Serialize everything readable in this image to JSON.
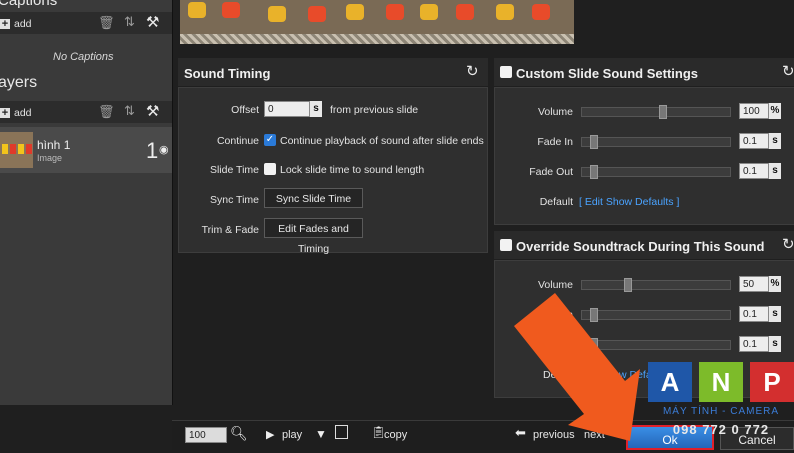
{
  "captions": {
    "title": "Captions",
    "add_label": "add",
    "empty_note": "No Captions"
  },
  "layers": {
    "title": "ayers",
    "add_label": "add",
    "items": [
      {
        "name": "hình 1",
        "type": "Image",
        "number": "1"
      }
    ]
  },
  "sound_timing": {
    "title": "Sound Timing",
    "offset_label": "Offset",
    "offset_value": "0",
    "offset_unit": "s",
    "offset_suffix": "from previous slide",
    "continue_label": "Continue",
    "continue_text": "Continue playback of sound after slide ends",
    "continue_checked": true,
    "slide_time_label": "Slide Time",
    "slide_time_text": "Lock slide time to sound length",
    "slide_time_checked": false,
    "sync_time_label": "Sync Time",
    "sync_button": "Sync Slide Time",
    "trim_label": "Trim & Fade",
    "trim_button": "Edit Fades and Timing"
  },
  "custom_sound": {
    "title": "Custom Slide Sound Settings",
    "volume_label": "Volume",
    "volume_value": "100",
    "volume_unit": "%",
    "volume_level": 0.55,
    "fade_in_label": "Fade In",
    "fade_in_value": "0.1",
    "fade_in_unit": "s",
    "fade_out_label": "Fade Out",
    "fade_out_value": "0.1",
    "fade_out_unit": "s",
    "default_label": "Default",
    "default_link": "[ Edit Show Defaults ]"
  },
  "override": {
    "title": "Override Soundtrack During This Sound",
    "volume_label": "Volume",
    "volume_value": "50",
    "volume_unit": "%",
    "volume_level": 0.3,
    "fade_in_label": "Fade In",
    "fade_in_value": "0.1",
    "fade_in_unit": "s",
    "fade_out_value": "0.1",
    "fade_out_unit": "s",
    "default_partial": "De",
    "default_link_partial": "w Defaults ]"
  },
  "bottom": {
    "zoom_value": "100",
    "play_label": "play",
    "copy_label": "copy",
    "previous_label": "previous",
    "next_label": "next",
    "ok_label": "Ok",
    "cancel_label": "Cancel"
  },
  "watermark": {
    "letters": [
      "A",
      "N",
      "P"
    ],
    "line1": "MÁY TÍNH - CAMERA",
    "line2": "098 772 0 772"
  },
  "colors": {
    "accent_blue": "#2a7ad8",
    "arrow": "#f05a1e",
    "ok_border": "#e0202a",
    "logo_blue": "#1f57a8",
    "logo_green": "#7dbb2a",
    "logo_red": "#d32f2f"
  }
}
